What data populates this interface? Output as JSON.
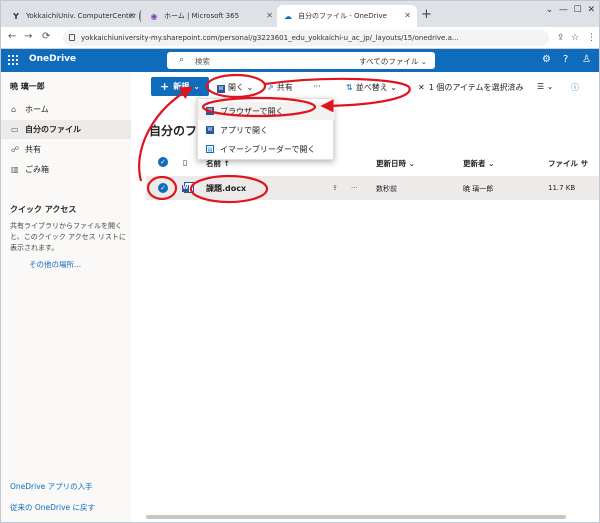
{
  "browser": {
    "tabs": [
      {
        "title": "YokkaichiUniv. ComputerCenter |"
      },
      {
        "title": "ホーム | Microsoft 365"
      },
      {
        "title": "自分のファイル - OneDrive"
      }
    ],
    "new_tab": "+",
    "url": "yokkaichiuniversity-my.sharepoint.com/personal/g3223601_edu_yokkaichi-u_ac_jp/_layouts/15/onedrive.a..."
  },
  "app": {
    "title": "OneDrive",
    "search_placeholder": "検索",
    "search_scope": "すべてのファイル"
  },
  "sidebar": {
    "user": "暁 璃一郎",
    "items": [
      {
        "label": "ホーム"
      },
      {
        "label": "自分のファイル"
      },
      {
        "label": "共有"
      },
      {
        "label": "ごみ箱"
      }
    ],
    "quick_access_title": "クイック アクセス",
    "quick_access_desc": "共有ライブラリからファイルを開くと、このクイック アクセス リストに表示されます。",
    "quick_access_link": "その他の場所...",
    "app_link": "OneDrive アプリの入手",
    "classic_link": "従来の OneDrive に戻す"
  },
  "commandbar": {
    "new_label": "新規",
    "open_label": "開く",
    "share_label": "共有",
    "more_label": "···",
    "sort_label": "並べ替え",
    "selection_text": "1 個のアイテムを選択済み"
  },
  "open_menu": {
    "items": [
      {
        "label": "ブラウザーで開く"
      },
      {
        "label": "アプリで開く"
      },
      {
        "label": "イマーシブリーダーで開く"
      }
    ]
  },
  "main": {
    "page_title": "自分のファイル",
    "columns": {
      "name": "名前",
      "modified": "更新日時",
      "modified_by": "更新者",
      "size": "ファイル サ"
    },
    "files": [
      {
        "name": "課題.docx",
        "modified": "数秒前",
        "modified_by": "暁 璃一郎",
        "size": "11.7 KB"
      }
    ]
  },
  "colors": {
    "brand": "#0f6cbd",
    "annotation": "#e0141e"
  }
}
